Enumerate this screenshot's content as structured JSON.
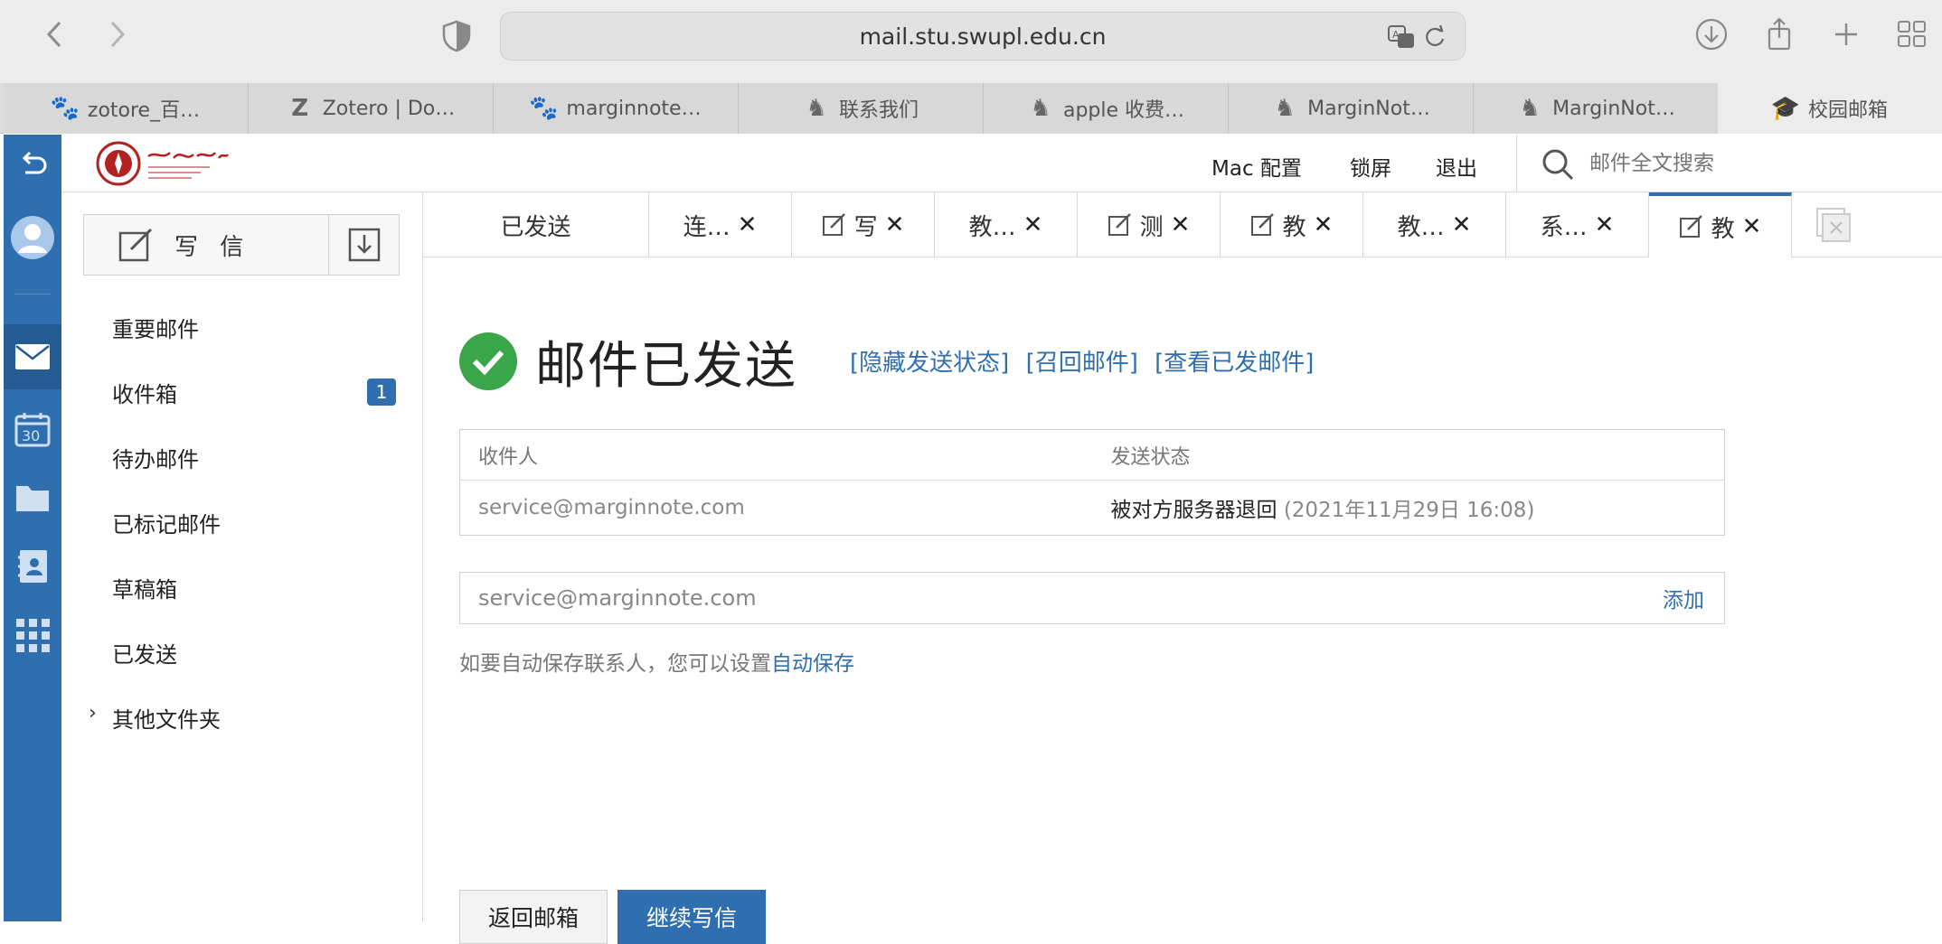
{
  "browser": {
    "url": "mail.stu.swupl.edu.cn",
    "tabs": [
      {
        "label": "zotore_百…",
        "icon": "baidu-paw-icon"
      },
      {
        "label": "Zotero | Do…",
        "icon": "zotero-z-icon"
      },
      {
        "label": "marginnote…",
        "icon": "baidu-paw-icon"
      },
      {
        "label": "联系我们",
        "icon": "marginnote-icon"
      },
      {
        "label": "apple 收费…",
        "icon": "marginnote-icon"
      },
      {
        "label": "MarginNot…",
        "icon": "marginnote-icon"
      },
      {
        "label": "MarginNot…",
        "icon": "marginnote-icon"
      },
      {
        "label": "校园邮箱",
        "icon": "graduation-cap-icon"
      }
    ]
  },
  "topbar": {
    "mac_config": "Mac 配置",
    "lock": "锁屏",
    "logout": "退出",
    "search_placeholder": "邮件全文搜索"
  },
  "sidebar": {
    "compose_label": "写 信",
    "folders": [
      {
        "label": "重要邮件"
      },
      {
        "label": "收件箱",
        "badge": "1"
      },
      {
        "label": "待办邮件"
      },
      {
        "label": "已标记邮件"
      },
      {
        "label": "草稿箱"
      },
      {
        "label": "已发送"
      },
      {
        "label": "其他文件夹"
      }
    ]
  },
  "mail_tabs": [
    {
      "label": "已发送",
      "compose": false,
      "closable": false
    },
    {
      "label": "连…",
      "compose": false,
      "closable": true
    },
    {
      "label": "写",
      "compose": true,
      "closable": true
    },
    {
      "label": "教…",
      "compose": false,
      "closable": true
    },
    {
      "label": "测",
      "compose": true,
      "closable": true
    },
    {
      "label": "教",
      "compose": true,
      "closable": true
    },
    {
      "label": "教…",
      "compose": false,
      "closable": true
    },
    {
      "label": "系…",
      "compose": false,
      "closable": true
    },
    {
      "label": "教",
      "compose": true,
      "closable": true,
      "active": true
    }
  ],
  "main": {
    "title": "邮件已发送",
    "links": [
      "[隐藏发送状态]",
      "[召回邮件]",
      "[查看已发邮件]"
    ],
    "table": {
      "headers": [
        "收件人",
        "发送状态"
      ],
      "rows": [
        {
          "recipient": "service@marginnote.com",
          "status": "被对方服务器退回",
          "time": "(2021年11月29日 16:08)"
        }
      ]
    },
    "add_contact": {
      "address": "service@marginnote.com",
      "action": "添加"
    },
    "hint": "如要自动保存联系人，您可以设置",
    "hint_link": "自动保存",
    "back_button": "返回邮箱",
    "continue_button": "继续写信"
  },
  "colors": {
    "accent": "#2f6fb0",
    "success": "#3aa64a",
    "rail": "#2f6fb0"
  }
}
